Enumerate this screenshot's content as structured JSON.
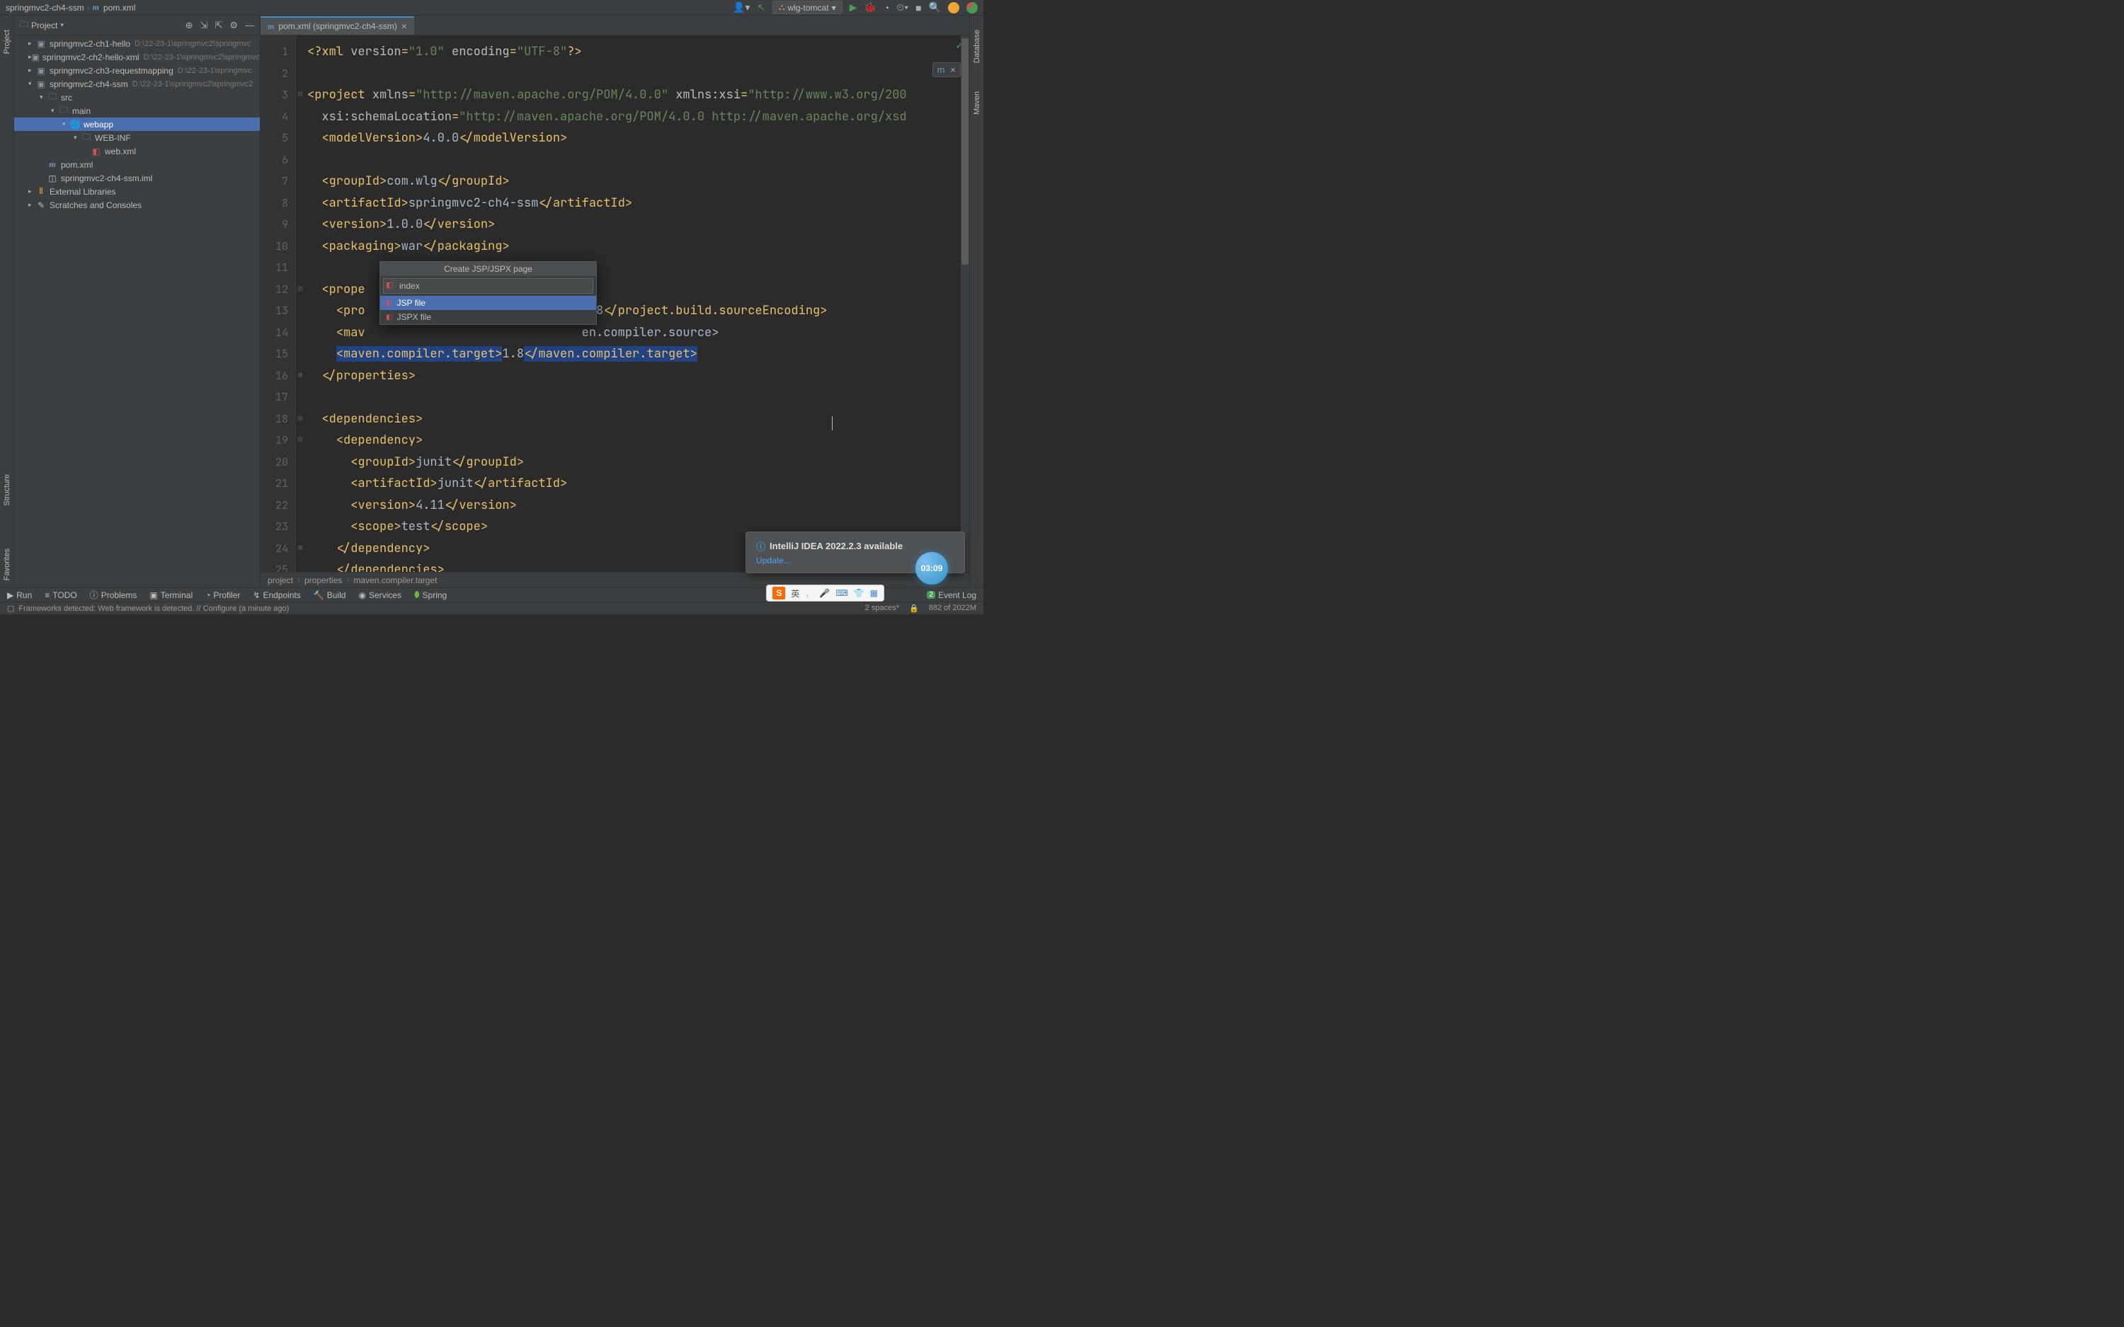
{
  "nav": {
    "project": "springmvc2-ch4-ssm",
    "file": "pom.xml"
  },
  "toolbar": {
    "run_config": "wlg-tomcat"
  },
  "project_panel": {
    "title": "Project"
  },
  "tree": {
    "items": [
      {
        "indent": 1,
        "arrow": "closed",
        "icon": "module",
        "label": "springmvc2-ch1-hello",
        "hint": "D:\\22-23-1\\springmvc2\\springmvc"
      },
      {
        "indent": 1,
        "arrow": "closed",
        "icon": "module",
        "label": "springmvc2-ch2-hello-xml",
        "hint": "D:\\22-23-1\\springmvc2\\springmvc"
      },
      {
        "indent": 1,
        "arrow": "closed",
        "icon": "module",
        "label": "springmvc2-ch3-requestmapping",
        "hint": "D:\\22-23-1\\springmvc"
      },
      {
        "indent": 1,
        "arrow": "open",
        "icon": "module",
        "label": "springmvc2-ch4-ssm",
        "hint": "D:\\22-23-1\\springmvc2\\springmvc2"
      },
      {
        "indent": 2,
        "arrow": "open",
        "icon": "folder",
        "label": "src",
        "hint": ""
      },
      {
        "indent": 3,
        "arrow": "open",
        "icon": "folder",
        "label": "main",
        "hint": ""
      },
      {
        "indent": 4,
        "arrow": "open",
        "icon": "webapp",
        "label": "webapp",
        "hint": "",
        "selected": true
      },
      {
        "indent": 5,
        "arrow": "open",
        "icon": "folder",
        "label": "WEB-INF",
        "hint": ""
      },
      {
        "indent": 5,
        "arrow": "none",
        "icon": "xml",
        "label": "web.xml",
        "hint": "",
        "extra_indent": true
      },
      {
        "indent": 2,
        "arrow": "none",
        "icon": "maven",
        "label": "pom.xml",
        "hint": ""
      },
      {
        "indent": 2,
        "arrow": "none",
        "icon": "iml",
        "label": "springmvc2-ch4-ssm.iml",
        "hint": ""
      },
      {
        "indent": 1,
        "arrow": "closed",
        "icon": "lib",
        "label": "External Libraries",
        "hint": ""
      },
      {
        "indent": 1,
        "arrow": "closed",
        "icon": "scratch",
        "label": "Scratches and Consoles",
        "hint": ""
      }
    ]
  },
  "editor_tab": {
    "label": "pom.xml (springmvc2-ch4-ssm)"
  },
  "code_lines": [
    {
      "n": 1,
      "fold": "",
      "html": "<span class='tag'>&lt;?xml</span> <span class='attr'>version</span><span class='tag'>=</span><span class='str'>\"1.0\"</span> <span class='attr'>encoding</span><span class='tag'>=</span><span class='str'>\"UTF-8\"</span><span class='tag'>?&gt;</span>"
    },
    {
      "n": 2,
      "fold": "",
      "html": ""
    },
    {
      "n": 3,
      "fold": "⊟",
      "html": "<span class='tag'>&lt;project</span> <span class='attr'>xmlns</span><span class='tag'>=</span><span class='str'>\"http://maven.apache.org/POM/4.0.0\"</span> <span class='attr'>xmlns:xsi</span><span class='tag'>=</span><span class='str'>\"http://www.w3.org/200</span>"
    },
    {
      "n": 4,
      "fold": "",
      "html": "  <span class='attr'>xsi:schemaLocation</span><span class='tag'>=</span><span class='str'>\"http://maven.apache.org/POM/4.0.0 http://maven.apache.org/xsd</span>"
    },
    {
      "n": 5,
      "fold": "",
      "html": "  <span class='tag'>&lt;modelVersion&gt;</span><span class='txt'>4.0.0</span><span class='tag'>&lt;/modelVersion&gt;</span>"
    },
    {
      "n": 6,
      "fold": "",
      "html": ""
    },
    {
      "n": 7,
      "fold": "",
      "html": "  <span class='tag'>&lt;groupId&gt;</span><span class='txt'>com.wlg</span><span class='tag'>&lt;/groupId&gt;</span>"
    },
    {
      "n": 8,
      "fold": "",
      "html": "  <span class='tag'>&lt;artifactId&gt;</span><span class='txt'>springmvc2-ch4-ssm</span><span class='tag'>&lt;/artifactId&gt;</span>"
    },
    {
      "n": 9,
      "fold": "",
      "html": "  <span class='tag'>&lt;version&gt;</span><span class='txt'>1.0.0</span><span class='tag'>&lt;/version&gt;</span>"
    },
    {
      "n": 10,
      "fold": "",
      "html": "  <span class='tag'>&lt;packaging&gt;</span><span class='txt'>war</span><span class='tag'>&lt;/packaging&gt;</span>"
    },
    {
      "n": 11,
      "fold": "",
      "html": ""
    },
    {
      "n": 12,
      "fold": "⊟",
      "html": "  <span class='tag'>&lt;prope</span>"
    },
    {
      "n": 13,
      "fold": "",
      "html": "    <span class='tag'>&lt;pro</span>                              <span class='txt'>F-8</span><span class='tag'>&lt;/project.build.sourceEncoding&gt;</span>"
    },
    {
      "n": 14,
      "fold": "",
      "html": "    <span class='tag'>&lt;mav</span>                              <span class='txt'>en.compiler.source&gt;</span>"
    },
    {
      "n": 15,
      "fold": "",
      "html": "    <span class='hl'><span class='tag'>&lt;maven.compiler.target&gt;</span></span><span class='txt'>1.8</span><span class='hl'><span class='tag'>&lt;/maven.compiler.target&gt;</span></span>"
    },
    {
      "n": 16,
      "fold": "⊞",
      "html": "  <span class='tag'>&lt;/properties&gt;</span>"
    },
    {
      "n": 17,
      "fold": "",
      "html": ""
    },
    {
      "n": 18,
      "fold": "⊟",
      "html": "  <span class='tag'>&lt;dependencies&gt;</span>"
    },
    {
      "n": 19,
      "fold": "⊟",
      "html": "    <span class='tag'>&lt;dependency&gt;</span>"
    },
    {
      "n": 20,
      "fold": "",
      "html": "      <span class='tag'>&lt;groupId&gt;</span><span class='txt'>junit</span><span class='tag'>&lt;/groupId&gt;</span>"
    },
    {
      "n": 21,
      "fold": "",
      "html": "      <span class='tag'>&lt;artifactId&gt;</span><span class='txt'>junit</span><span class='tag'>&lt;/artifactId&gt;</span>"
    },
    {
      "n": 22,
      "fold": "",
      "html": "      <span class='tag'>&lt;version&gt;</span><span class='txt'>4.11</span><span class='tag'>&lt;/version&gt;</span>"
    },
    {
      "n": 23,
      "fold": "",
      "html": "      <span class='tag'>&lt;scope&gt;</span><span class='txt'>test</span><span class='tag'>&lt;/scope&gt;</span>"
    },
    {
      "n": 24,
      "fold": "⊞",
      "html": "    <span class='tag'>&lt;/dependency&gt;</span>"
    },
    {
      "n": 25,
      "fold": "",
      "html": "    <span class='tag'>&lt;/dependencies&gt;</span>"
    }
  ],
  "popup": {
    "title": "Create JSP/JSPX page",
    "input": "index",
    "items": [
      {
        "label": "JSP file",
        "sel": true,
        "icon": "jsp"
      },
      {
        "label": "JSPX file",
        "sel": false,
        "icon": "jspx"
      }
    ]
  },
  "editor_crumb": {
    "a": "project",
    "b": "properties",
    "c": "maven.compiler.target"
  },
  "notification": {
    "title": "IntelliJ IDEA 2022.2.3 available",
    "link": "Update..."
  },
  "clock": "03:09",
  "bottom": {
    "run": "Run",
    "todo": "TODO",
    "problems": "Problems",
    "terminal": "Terminal",
    "profiler": "Profiler",
    "endpoints": "Endpoints",
    "build": "Build",
    "services": "Services",
    "spring": "Spring",
    "eventlog": "Event Log",
    "event_count": "2"
  },
  "status": {
    "msg": "Frameworks detected: Web framework is detected. // Configure (a minute ago)",
    "spaces": "2 spaces*",
    "mem": "882 of 2022M"
  },
  "left_tools": {
    "project": "Project",
    "structure": "Structure",
    "favorites": "Favorites"
  },
  "right_tools": {
    "database": "Database",
    "maven": "Maven"
  },
  "ime": {
    "lang": "英"
  }
}
